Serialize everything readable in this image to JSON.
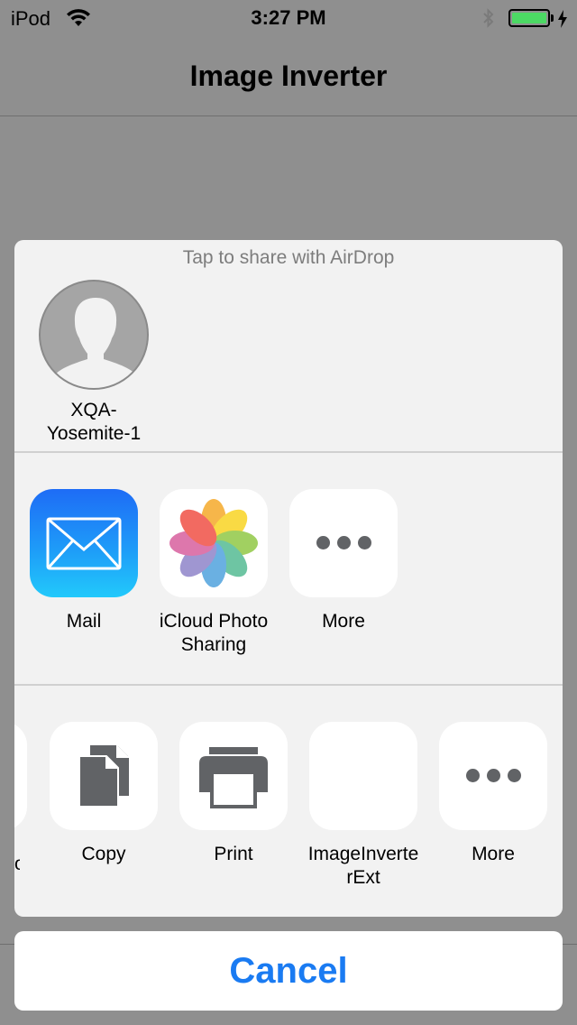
{
  "status_bar": {
    "carrier": "iPod",
    "time": "3:27 PM",
    "battery_color": "#4cd964"
  },
  "nav": {
    "title": "Image Inverter"
  },
  "share_sheet": {
    "airdrop_hint": "Tap to share with AirDrop",
    "airdrop_contacts": [
      {
        "name_line1": "XQA-",
        "name_line2": "Yosemite-1",
        "icon": "person-silhouette-icon"
      }
    ],
    "apps": [
      {
        "label": "Mail",
        "icon": "mail-icon"
      },
      {
        "label_line1": "iCloud Photo",
        "label_line2": "Sharing",
        "icon": "photos-icon"
      },
      {
        "label": "More",
        "icon": "more-icon"
      }
    ],
    "actions": [
      {
        "label": "Copy",
        "icon": "copy-icon"
      },
      {
        "label": "Print",
        "icon": "print-icon"
      },
      {
        "label_line1": "ImageInverte",
        "label_line2": "rExt",
        "icon": "blank-extension-icon"
      },
      {
        "label": "More",
        "icon": "more-icon"
      }
    ],
    "partial_label_fragment": "o"
  },
  "cancel": {
    "label": "Cancel",
    "color": "#1a7bf2"
  }
}
